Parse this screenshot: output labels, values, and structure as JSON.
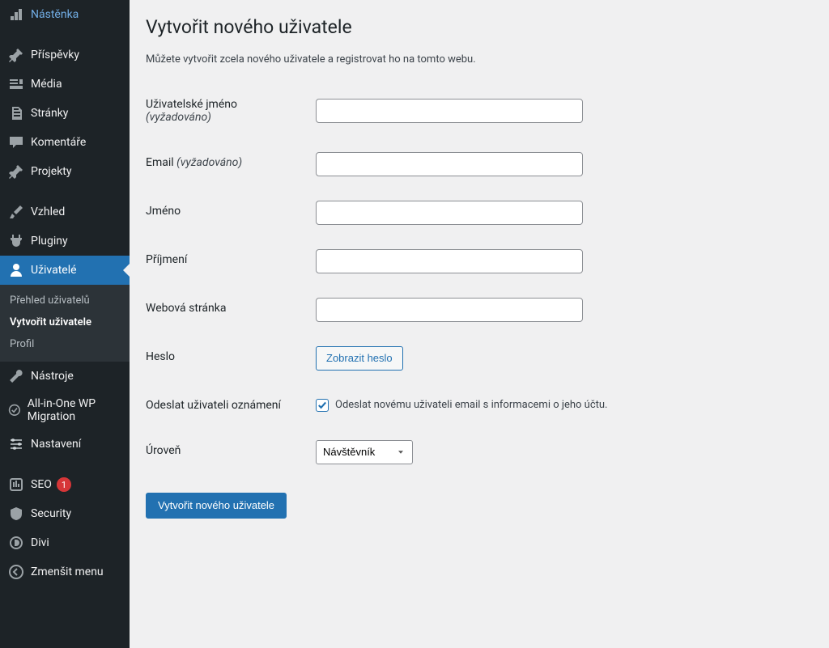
{
  "sidebar": {
    "items": [
      {
        "key": "dashboard",
        "label": "Nástěnka",
        "icon": "dashboard-icon"
      },
      {
        "key": "posts",
        "label": "Příspěvky",
        "icon": "pin-icon"
      },
      {
        "key": "media",
        "label": "Média",
        "icon": "media-icon"
      },
      {
        "key": "pages",
        "label": "Stránky",
        "icon": "pages-icon"
      },
      {
        "key": "comments",
        "label": "Komentáře",
        "icon": "comment-icon"
      },
      {
        "key": "projects",
        "label": "Projekty",
        "icon": "pin-icon"
      },
      {
        "key": "appearance",
        "label": "Vzhled",
        "icon": "brush-icon"
      },
      {
        "key": "plugins",
        "label": "Pluginy",
        "icon": "plug-icon"
      },
      {
        "key": "users",
        "label": "Uživatelé",
        "icon": "user-icon",
        "current": true,
        "submenu": [
          {
            "key": "overview",
            "label": "Přehled uživatelů"
          },
          {
            "key": "create",
            "label": "Vytvořit uživatele",
            "current": true
          },
          {
            "key": "profile",
            "label": "Profil"
          }
        ]
      },
      {
        "key": "tools",
        "label": "Nástroje",
        "icon": "wrench-icon"
      },
      {
        "key": "aio",
        "label": "All-in-One WP Migration",
        "icon": "migration-icon"
      },
      {
        "key": "settings",
        "label": "Nastavení",
        "icon": "sliders-icon"
      },
      {
        "key": "seo",
        "label": "SEO",
        "icon": "seo-icon",
        "badge": "1"
      },
      {
        "key": "security",
        "label": "Security",
        "icon": "shield-icon"
      },
      {
        "key": "divi",
        "label": "Divi",
        "icon": "divi-icon"
      },
      {
        "key": "collapse",
        "label": "Zmenšit menu",
        "icon": "collapse-icon"
      }
    ]
  },
  "page": {
    "title": "Vytvořit nového uživatele",
    "desc": "Můžete vytvořit zcela nového uživatele a registrovat ho na tomto webu."
  },
  "form": {
    "username_label": "Uživatelské jméno",
    "username_req": "(vyžadováno)",
    "email_label": "Email",
    "email_req": "(vyžadováno)",
    "firstname_label": "Jméno",
    "lastname_label": "Příjmení",
    "website_label": "Webová stránka",
    "password_label": "Heslo",
    "show_password_btn": "Zobrazit heslo",
    "notify_label": "Odeslat uživateli oznámení",
    "notify_checkbox": "Odeslat novému uživateli email s informacemi o jeho účtu.",
    "role_label": "Úroveň",
    "role_value": "Návštěvník",
    "submit": "Vytvořit nového uživatele"
  }
}
